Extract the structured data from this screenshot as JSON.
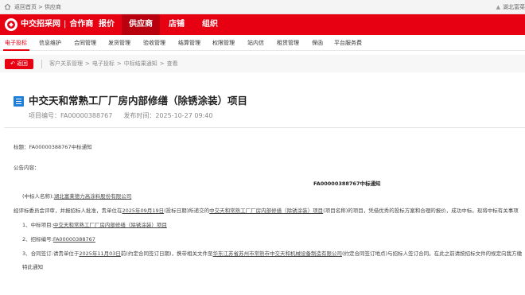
{
  "topbar": {
    "home_label": "返回首页",
    "separator": ">",
    "current": "供应商",
    "company": "湖北富菜"
  },
  "brand": {
    "name": "中交招采网",
    "channel": "合作商",
    "accent": "#e60012"
  },
  "main_nav": [
    "报价",
    "供应商",
    "店铺",
    "组织"
  ],
  "main_nav_active": "供应商",
  "sub_nav": [
    "电子投标",
    "信息维护",
    "合同管理",
    "发货管理",
    "验收管理",
    "结算管理",
    "权限管理",
    "站内信",
    "租赁管理",
    "保函",
    "平台服务费"
  ],
  "sub_nav_active": "电子投标",
  "back_button": "返回",
  "breadcrumb": [
    "客户关系管理",
    "电子投标",
    "中标结果通知",
    "查看"
  ],
  "breadcrumb_sep": ">",
  "notice": {
    "title": "中交天和常熟工厂厂房内部修缮（除锈涂装）项目",
    "project_no_label": "项目编号：",
    "project_no": "FA00000388767",
    "publish_label": "发布时间：",
    "publish_time": "2025-10-27 09:40",
    "subject_label": "标题：",
    "subject": "FA00000388767中标通知",
    "content_label": "公告内容：",
    "content_title": "FA00000388767中标通知",
    "recipient_prefix": "(中标人名称):",
    "recipient": "湖北富莱德力高涂料股份有限公司",
    "p1_a": "经评标委员会评审，并报招标人批准，贵单位在",
    "p1_date": "2025年09月19日",
    "p1_b": "(投标日期)所递交的",
    "p1_project": "中交天和常熟工厂厂房内部修缮（除锈涂装）项目",
    "p1_c": "(项目名称)的项目，凭借优秀的投标方案和合理的报价，成功中标。现将中标有关事项",
    "item1_label": "1、中标项目:",
    "item1_value": "中交天和常熟工厂厂房内部修缮（除锈涂装）项目",
    "item2_label": "2、招标编号:",
    "item2_value": "FA00000388767",
    "item3_a": "3、合同签订:请贵单位于",
    "item3_date": "2025年11月03日",
    "item3_b": "前(约定合同签订日期)，携带相关文件至",
    "item3_place": "华东江苏省苏州市常熟市中交天和机械设备制造有限公司",
    "item3_c": "(约定合同签订地点)与招标人签订合同。在此之前请按招标文件的规定向我方缴",
    "closing": "特此通知"
  }
}
